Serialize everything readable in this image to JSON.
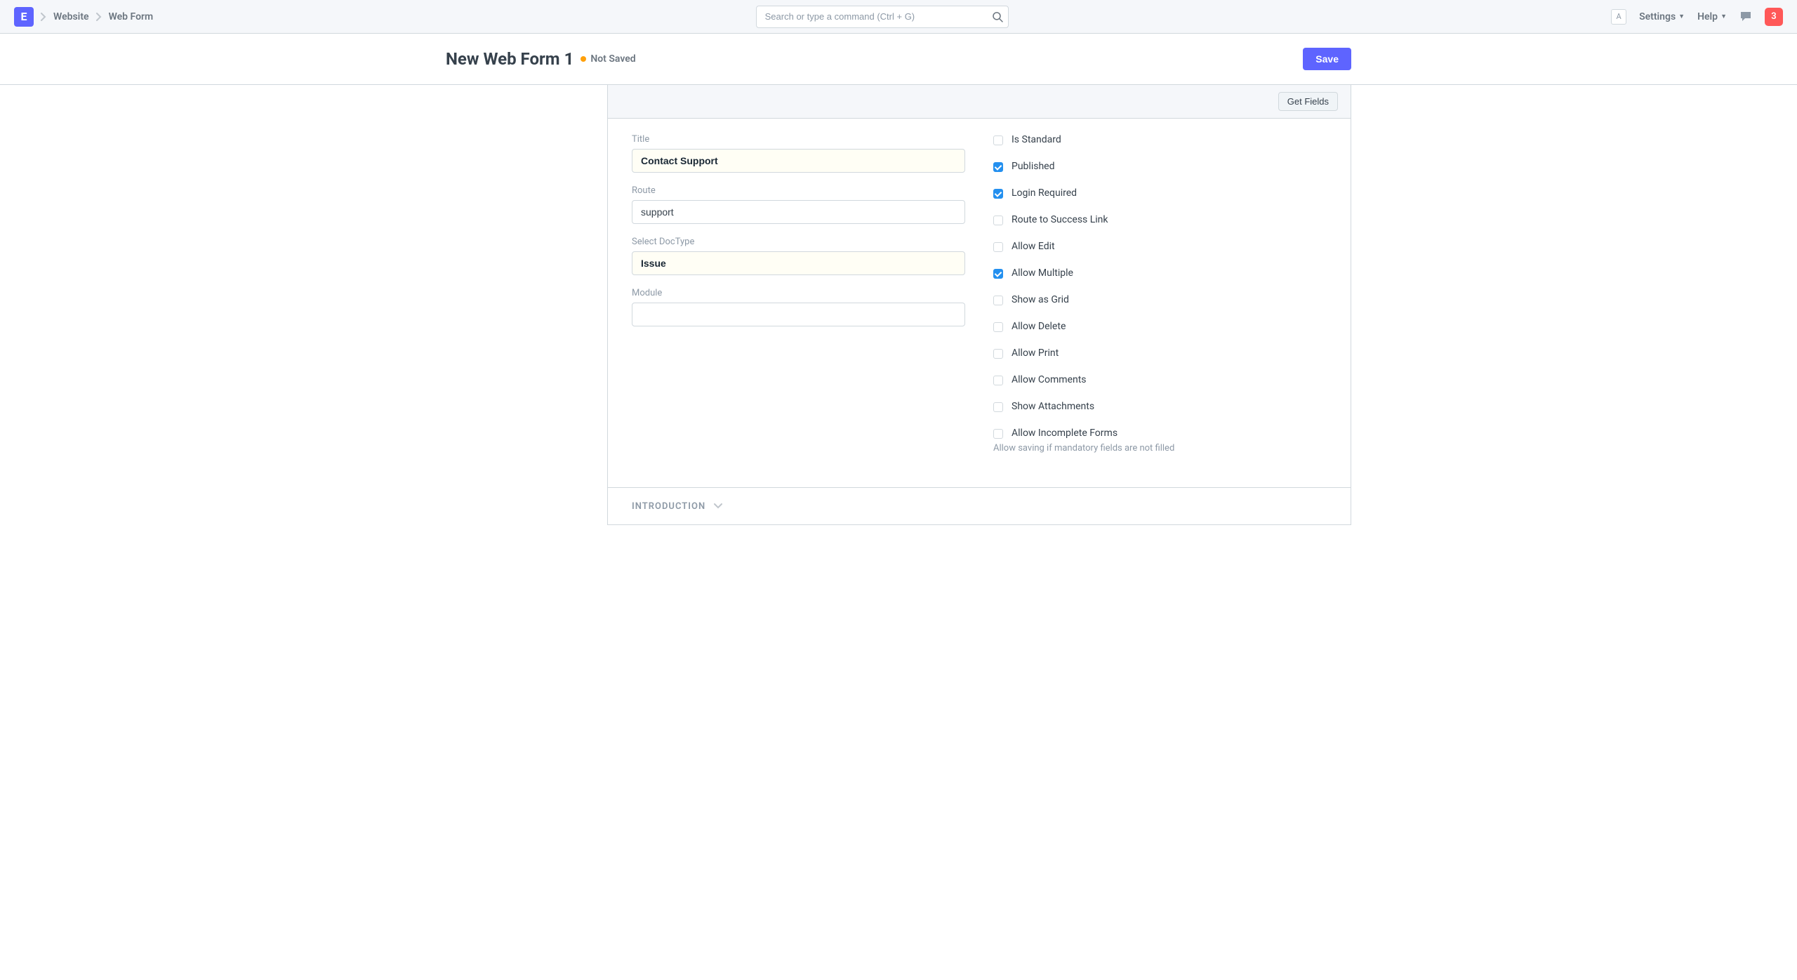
{
  "navbar": {
    "logo_letter": "E",
    "breadcrumbs": [
      "Website",
      "Web Form"
    ],
    "search_placeholder": "Search or type a command (Ctrl + G)",
    "avatar_letter": "A",
    "settings_label": "Settings",
    "help_label": "Help",
    "notification_count": "3"
  },
  "page": {
    "title": "New Web Form 1",
    "status_label": "Not Saved",
    "save_label": "Save"
  },
  "toolbar": {
    "get_fields_label": "Get Fields"
  },
  "form": {
    "left": {
      "title_label": "Title",
      "title_value": "Contact Support",
      "route_label": "Route",
      "route_value": "support",
      "doctype_label": "Select DocType",
      "doctype_value": "Issue",
      "module_label": "Module",
      "module_value": ""
    },
    "right": {
      "is_standard": {
        "label": "Is Standard",
        "checked": false
      },
      "published": {
        "label": "Published",
        "checked": true
      },
      "login_required": {
        "label": "Login Required",
        "checked": true
      },
      "route_success": {
        "label": "Route to Success Link",
        "checked": false
      },
      "allow_edit": {
        "label": "Allow Edit",
        "checked": false
      },
      "allow_multiple": {
        "label": "Allow Multiple",
        "checked": true
      },
      "show_as_grid": {
        "label": "Show as Grid",
        "checked": false
      },
      "allow_delete": {
        "label": "Allow Delete",
        "checked": false
      },
      "allow_print": {
        "label": "Allow Print",
        "checked": false
      },
      "allow_comments": {
        "label": "Allow Comments",
        "checked": false
      },
      "show_attachments": {
        "label": "Show Attachments",
        "checked": false
      },
      "allow_incomplete": {
        "label": "Allow Incomplete Forms",
        "checked": false
      },
      "allow_incomplete_help": "Allow saving if mandatory fields are not filled"
    }
  },
  "sections": {
    "introduction": "INTRODUCTION"
  }
}
